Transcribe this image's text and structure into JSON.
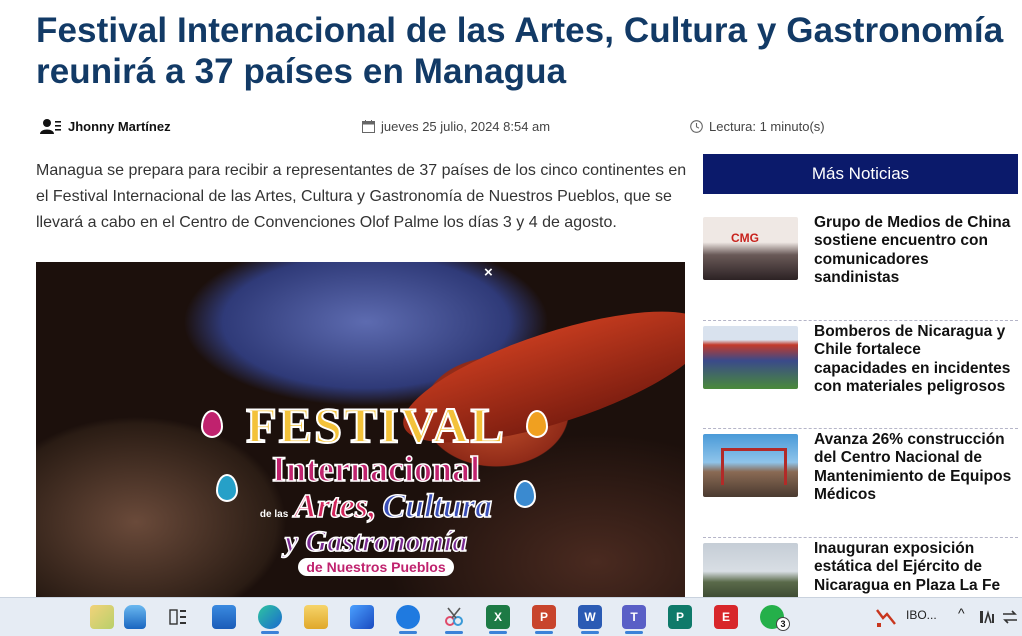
{
  "article": {
    "headline_line1": "Festival Internacional de las Artes, Cultura y Gastronomía",
    "headline_line2": "reunirá a 37 países en Managua",
    "author": "Jhonny Martínez",
    "date": "jueves 25 julio, 2024 8:54 am",
    "reading_time": "Lectura: 1 minuto(s)",
    "lead": "Managua se prepara para recibir a representantes de 37 países de los cinco continentes en el Festival Internacional de las Artes, Cultura y Gastronomía de Nuestros Pueblos, que se llevará a cabo en el Centro de Convenciones Olof Palme los días 3 y 4 de agosto.",
    "hero": {
      "close": "×",
      "word_festival": "FESTIVAL",
      "word_internacional": "Internacional",
      "word_de_las": "de las",
      "word_artes": "Artes,",
      "word_cultura": "Cultura",
      "word_gastronomia": "y Gastronomía",
      "word_pueblos": "de Nuestros Pueblos"
    }
  },
  "sidebar": {
    "header": "Más Noticias",
    "items": [
      {
        "title": "Grupo de Medios de China sostiene encuentro con comunicadores sandinistas"
      },
      {
        "title": "Bomberos de Nicaragua y Chile fortalece capacidades en incidentes con materiales peligrosos"
      },
      {
        "title": "Avanza 26% construcción del Centro Nacional de Mantenimiento de Equipos Médicos"
      },
      {
        "title": "Inauguran exposición estática del Ejército de Nicaragua en Plaza La Fe"
      }
    ]
  },
  "taskbar": {
    "whatsapp_badge": "3",
    "tray_label": "IBO...",
    "colors": {
      "excel": "#1d7a45",
      "powerpoint": "#c8442c",
      "word": "#2b5bb4",
      "teams": "#5a5fc6",
      "publisher": "#0f7a6a",
      "red_app": "#d8262a",
      "whatsapp": "#25b04a"
    }
  },
  "colors": {
    "headline": "#123a66",
    "sidebar_header_bg": "#0b1a6b"
  }
}
